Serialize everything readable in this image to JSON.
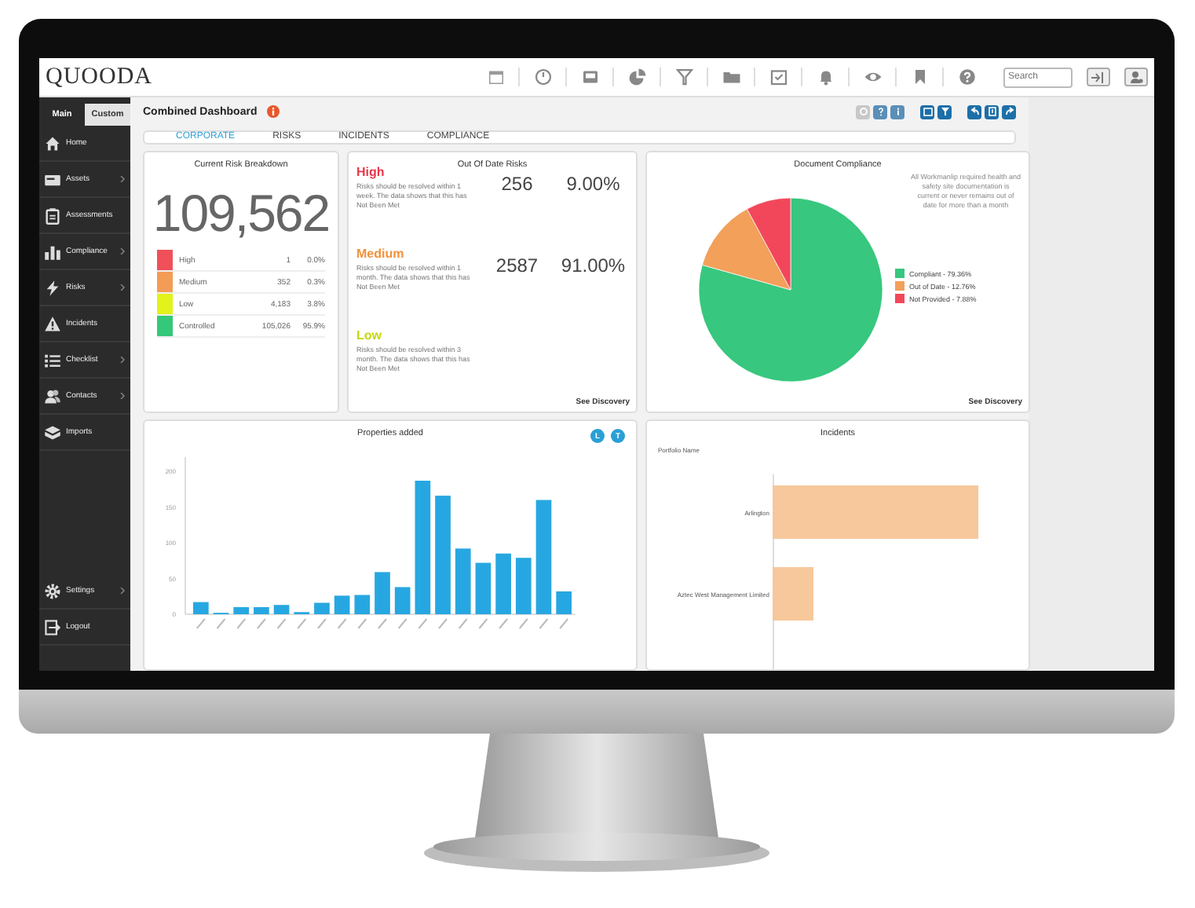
{
  "topbar": {
    "logo": "QUOODA",
    "search": {
      "placeholder": "Search"
    }
  },
  "sidebar": {
    "tabs": [
      {
        "label": "Main",
        "selected": true
      },
      {
        "label": "Custom",
        "selected": false
      }
    ],
    "items": [
      {
        "label": "Home",
        "kind": "home",
        "expandable": false
      },
      {
        "label": "Assets",
        "kind": "assets",
        "expandable": true
      },
      {
        "label": "Assessments",
        "kind": "assessments",
        "expandable": false
      },
      {
        "label": "Compliance",
        "kind": "compliance",
        "expandable": true
      },
      {
        "label": "Risks",
        "kind": "risks",
        "expandable": true
      },
      {
        "label": "Incidents",
        "kind": "incidents",
        "expandable": false
      },
      {
        "label": "Checklist",
        "kind": "checklist",
        "expandable": true
      },
      {
        "label": "Contacts",
        "kind": "contacts",
        "expandable": true
      },
      {
        "label": "Imports",
        "kind": "imports",
        "expandable": false
      }
    ],
    "bottom_items": [
      {
        "label": "Settings",
        "kind": "settings",
        "expandable": true
      },
      {
        "label": "Logout",
        "kind": "logout",
        "expandable": false
      }
    ]
  },
  "header": {
    "title": "Combined Dashboard"
  },
  "tabs": [
    {
      "label": "CORPORATE",
      "selected": true
    },
    {
      "label": "RISKS",
      "selected": false
    },
    {
      "label": "INCIDENTS",
      "selected": false
    },
    {
      "label": "COMPLIANCE",
      "selected": false
    }
  ],
  "risk_breakdown": {
    "title": "Current Risk Breakdown",
    "total": "109,562",
    "rows": [
      {
        "label": "High",
        "count": "1",
        "percent": "0.0%",
        "color": "#f0505a"
      },
      {
        "label": "Medium",
        "count": "352",
        "percent": "0.3%",
        "color": "#f39c55"
      },
      {
        "label": "Low",
        "count": "4,183",
        "percent": "3.8%",
        "color": "#e2f21a"
      },
      {
        "label": "Controlled",
        "count": "105,026",
        "percent": "95.9%",
        "color": "#35c77a"
      }
    ]
  },
  "out_of_date": {
    "title": "Out Of Date Risks",
    "sections": [
      {
        "label": "High",
        "color": "#e8374a",
        "description": "Risks should be resolved within 1 week. The data shows that this has Not Been Met",
        "count": "256",
        "percent": "9.00%"
      },
      {
        "label": "Medium",
        "color": "#f0923c",
        "description": "Risks should be resolved within 1 month. The data shows that this has Not Been Met",
        "count": "2587",
        "percent": "91.00%"
      },
      {
        "label": "Low",
        "color": "#c6d800",
        "description": "Risks should be resolved within 3 month. The data shows that this has Not Been Met"
      }
    ],
    "link": "See Discovery"
  },
  "document_compliance": {
    "title": "Document Compliance",
    "note": "All Workmanlip required health and safety site documentation is current or never remains out of date for more than a month",
    "legend": [
      {
        "label": "Compliant - 79.36%",
        "color": "#37c77e"
      },
      {
        "label": "Out of Date - 12.76%",
        "color": "#f2a05a"
      },
      {
        "label": "Not Provided - 7.88%",
        "color": "#f2475a"
      }
    ],
    "chart_data": {
      "type": "pie",
      "values": [
        79.36,
        12.76,
        7.88
      ]
    },
    "link": "See Discovery"
  },
  "properties": {
    "title": "Properties added",
    "buttons": [
      "L",
      "T"
    ],
    "chart_data": {
      "type": "bar",
      "ylim": [
        0,
        220
      ],
      "yticks": [
        0,
        50,
        100,
        150,
        200
      ],
      "values": [
        17,
        2,
        10,
        10,
        13,
        3,
        16,
        26,
        27,
        59,
        38,
        187,
        166,
        92,
        72,
        85,
        79,
        160,
        32
      ]
    }
  },
  "incidents": {
    "title": "Incidents",
    "axis_label": "Portfolio Name",
    "bars": [
      {
        "label": "Arlington"
      },
      {
        "label": "Aztec West Management Limited"
      }
    ]
  }
}
